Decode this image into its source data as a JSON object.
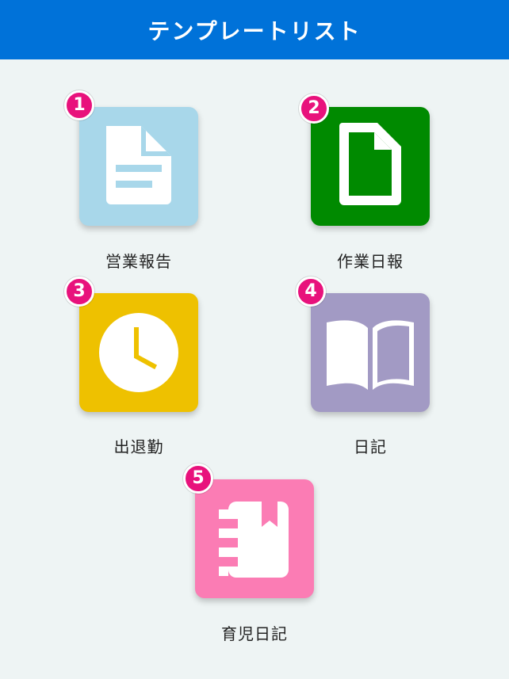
{
  "header": {
    "title": "テンプレートリスト",
    "background_color": "#0072d9"
  },
  "templates": [
    {
      "badge": "1",
      "label": "営業報告",
      "icon": "document-lines-icon",
      "color": "#a8d7ea"
    },
    {
      "badge": "2",
      "label": "作業日報",
      "icon": "blank-document-icon",
      "color": "#008a00"
    },
    {
      "badge": "3",
      "label": "出退勤",
      "icon": "clock-icon",
      "color": "#eec100"
    },
    {
      "badge": "4",
      "label": "日記",
      "icon": "open-book-icon",
      "color": "#a29ac4"
    },
    {
      "badge": "5",
      "label": "育児日記",
      "icon": "notebook-bookmark-icon",
      "color": "#fb7cb4"
    }
  ],
  "badge_color": "#e8127c"
}
